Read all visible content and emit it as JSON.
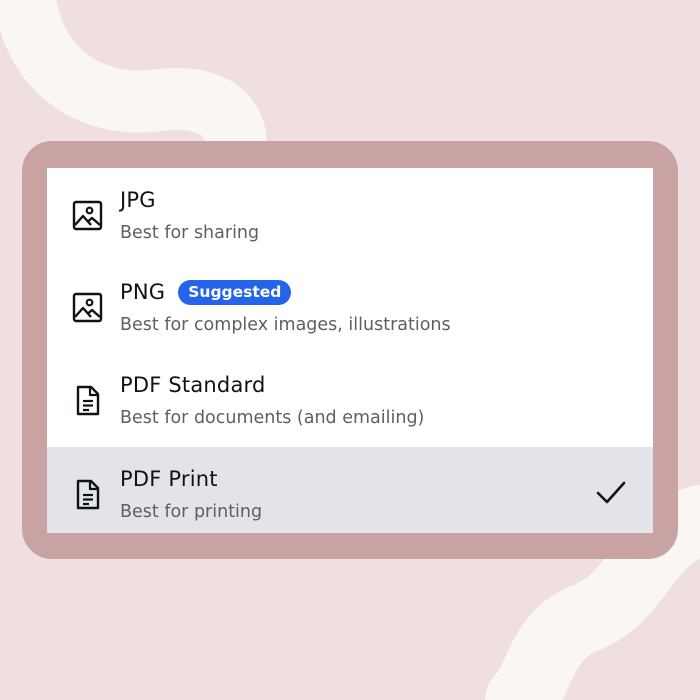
{
  "colors": {
    "background": "#f0dfe0",
    "frame": "#c9a3a3",
    "panel": "#ffffff",
    "selected_row": "#e2e4e9",
    "badge": "#2563eb",
    "swirl": "#faf6f3"
  },
  "options": [
    {
      "title": "JPG",
      "description": "Best for sharing",
      "icon": "image-icon",
      "badge": null,
      "selected": false
    },
    {
      "title": "PNG",
      "description": "Best for complex images, illustrations",
      "icon": "image-icon",
      "badge": "Suggested",
      "selected": false
    },
    {
      "title": "PDF Standard",
      "description": "Best for documents (and emailing)",
      "icon": "document-icon",
      "badge": null,
      "selected": false
    },
    {
      "title": "PDF Print",
      "description": "Best for printing",
      "icon": "document-icon",
      "badge": null,
      "selected": true
    }
  ]
}
